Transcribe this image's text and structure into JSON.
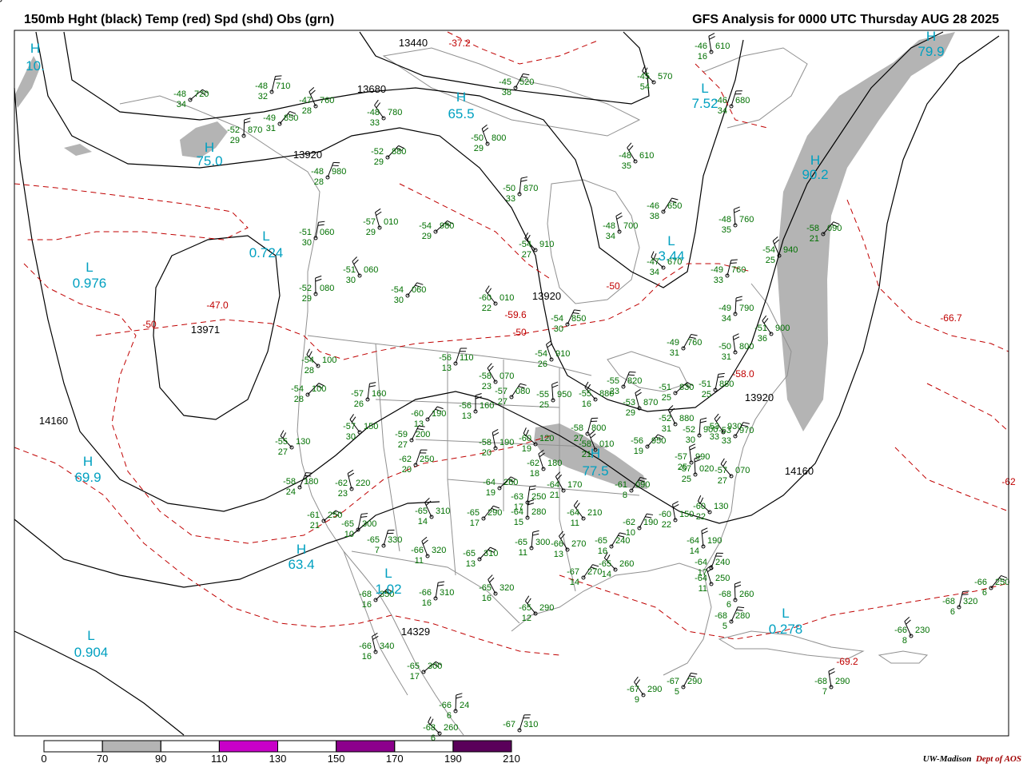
{
  "header": {
    "title_left": "150mb Hght (black) Temp (red) Spd (shd) Obs (grn)",
    "title_right": "GFS Analysis for 0000 UTC Thursday  AUG 28 2025"
  },
  "credit": {
    "institution": "UW-Madison",
    "dept": "Dept of AOS"
  },
  "colors": {
    "height": "#000000",
    "temp": "#c00000",
    "obs": "#007000",
    "centers": "#00a0c0",
    "map_lines": "#909090",
    "shade_70": "#b4b4b4",
    "shade_110": "#c800c8",
    "shade_150": "#8c008c",
    "shade_190": "#5a005a"
  },
  "legend": {
    "ticks": [
      "0",
      "70",
      "90",
      "110",
      "130",
      "150",
      "170",
      "190",
      "210"
    ],
    "bins": [
      {
        "from": 70,
        "to": 90,
        "color": "#b4b4b4"
      },
      {
        "from": 110,
        "to": 130,
        "color": "#c800c8"
      },
      {
        "from": 150,
        "to": 170,
        "color": "#8c008c"
      },
      {
        "from": 190,
        "to": 210,
        "color": "#5a005a"
      }
    ]
  },
  "height_labels": [
    "13440",
    "13680",
    "13920",
    "13971",
    "14160",
    "14160",
    "13920",
    "13920",
    "14329"
  ],
  "temp_labels": [
    "-37.2",
    "-50",
    "-50",
    "-50",
    "-47.0",
    "-66.7",
    "-69.2",
    "-59.6",
    "-58.0",
    "-62"
  ],
  "centers": [
    {
      "type": "H",
      "value": "75.0"
    },
    {
      "type": "H",
      "value": "65.5"
    },
    {
      "type": "H",
      "value": "90.2"
    },
    {
      "type": "H",
      "value": "79.9"
    },
    {
      "type": "H",
      "value": "69.9"
    },
    {
      "type": "H",
      "value": "63.4"
    },
    {
      "type": "H",
      "value": "77.5"
    },
    {
      "type": "H",
      "value": "10."
    },
    {
      "type": "L",
      "value": "0.976"
    },
    {
      "type": "L",
      "value": "0.724"
    },
    {
      "type": "L",
      "value": "7.52"
    },
    {
      "type": "L",
      "value": "3.44"
    },
    {
      "type": "L",
      "value": "1.02"
    },
    {
      "type": "L",
      "value": "0.904"
    },
    {
      "type": "L",
      "value": "0.278"
    }
  ],
  "stations": [
    {
      "t": "-48",
      "h": "720",
      "s": "34"
    },
    {
      "t": "-48",
      "h": "710",
      "s": "32"
    },
    {
      "t": "-47",
      "h": "760",
      "s": "28"
    },
    {
      "t": "-49",
      "h": "850",
      "s": "31"
    },
    {
      "t": "-52",
      "h": "870",
      "s": "29"
    },
    {
      "t": "-48",
      "h": "780",
      "s": "33"
    },
    {
      "t": "-45",
      "h": "520",
      "s": "38"
    },
    {
      "t": "-46",
      "h": "610",
      "s": "16"
    },
    {
      "t": "-45",
      "h": "570",
      "s": "54"
    },
    {
      "t": "-46",
      "h": "680",
      "s": "34"
    },
    {
      "t": "-50",
      "h": "800",
      "s": "29"
    },
    {
      "t": "-52",
      "h": "880",
      "s": "29"
    },
    {
      "t": "-50",
      "h": "870",
      "s": "33"
    },
    {
      "t": "-48",
      "h": "610",
      "s": "35"
    },
    {
      "t": "-46",
      "h": "650",
      "s": "38"
    },
    {
      "t": "-48",
      "h": "760",
      "s": "35"
    },
    {
      "t": "-54",
      "h": "910",
      "s": "27"
    },
    {
      "t": "-48",
      "h": "980",
      "s": "28"
    },
    {
      "t": "-57",
      "h": "010",
      "s": "29"
    },
    {
      "t": "-54",
      "h": "980",
      "s": "29"
    },
    {
      "t": "-51",
      "h": "060",
      "s": "30"
    },
    {
      "t": "-51",
      "h": "060",
      "s": "30"
    },
    {
      "t": "-54",
      "h": "060",
      "s": "30"
    },
    {
      "t": "-52",
      "h": "080",
      "s": "29"
    },
    {
      "t": "-60",
      "h": "010",
      "s": "22"
    },
    {
      "t": "-54",
      "h": "850",
      "s": "30"
    },
    {
      "t": "-48",
      "h": "700",
      "s": "34"
    },
    {
      "t": "-47",
      "h": "670",
      "s": "34"
    },
    {
      "t": "-49",
      "h": "760",
      "s": "33"
    },
    {
      "t": "-54",
      "h": "940",
      "s": "25"
    },
    {
      "t": "-58",
      "h": "090",
      "s": "21"
    },
    {
      "t": "-49",
      "h": "790",
      "s": "34"
    },
    {
      "t": "-51",
      "h": "900",
      "s": "36"
    },
    {
      "t": "-49",
      "h": "760",
      "s": "31"
    },
    {
      "t": "-50",
      "h": "800",
      "s": "31"
    },
    {
      "t": "-54",
      "h": "100",
      "s": "28"
    },
    {
      "t": "-56",
      "h": "110",
      "s": "13"
    },
    {
      "t": "-54",
      "h": "910",
      "s": "26"
    },
    {
      "t": "-54",
      "h": "100",
      "s": "28"
    },
    {
      "t": "-57",
      "h": "160",
      "s": "26"
    },
    {
      "t": "-58",
      "h": "070",
      "s": "23"
    },
    {
      "t": "-57",
      "h": "080",
      "s": "27"
    },
    {
      "t": "-55",
      "h": "950",
      "s": "25"
    },
    {
      "t": "-55",
      "h": "880",
      "s": "16"
    },
    {
      "t": "-55",
      "h": "820",
      "s": "23"
    },
    {
      "t": "-53",
      "h": "870",
      "s": "29"
    },
    {
      "t": "-51",
      "h": "830",
      "s": "25"
    },
    {
      "t": "-51",
      "h": "880",
      "s": "25"
    },
    {
      "t": "-52",
      "h": "880",
      "s": "31"
    },
    {
      "t": "-60",
      "h": "190",
      "s": "13"
    },
    {
      "t": "-56",
      "h": "160",
      "s": "13"
    },
    {
      "t": "-57",
      "h": "150",
      "s": "30"
    },
    {
      "t": "-59",
      "h": "200",
      "s": "27"
    },
    {
      "t": "-58",
      "h": "190",
      "s": "20"
    },
    {
      "t": "-60",
      "h": "120",
      "s": "19"
    },
    {
      "t": "-58",
      "h": "800",
      "s": "27"
    },
    {
      "t": "-58",
      "h": "010",
      "s": "21"
    },
    {
      "t": "-56",
      "h": "950",
      "s": "19"
    },
    {
      "t": "-52",
      "h": "900",
      "s": "30"
    },
    {
      "t": "-53",
      "h": "930",
      "s": "33"
    },
    {
      "t": "-53",
      "h": "970",
      "s": "33"
    },
    {
      "t": "-57",
      "h": "990",
      "s": "25"
    },
    {
      "t": "-55",
      "h": "130",
      "s": "27"
    },
    {
      "t": "-62",
      "h": "250",
      "s": "20"
    },
    {
      "t": "-62",
      "h": "180",
      "s": "18"
    },
    {
      "t": "-64",
      "h": "260",
      "s": "19"
    },
    {
      "t": "-63",
      "h": "250",
      "s": "17"
    },
    {
      "t": "-64",
      "h": "170",
      "s": "21"
    },
    {
      "t": "-61",
      "h": "090",
      "s": "8"
    },
    {
      "t": "-57",
      "h": "020",
      "s": "25"
    },
    {
      "t": "-57",
      "h": "070",
      "s": "27"
    },
    {
      "t": "-58",
      "h": "180",
      "s": "24"
    },
    {
      "t": "-62",
      "h": "220",
      "s": "23"
    },
    {
      "t": "-61",
      "h": "250",
      "s": "21"
    },
    {
      "t": "-65",
      "h": "300",
      "s": "10"
    },
    {
      "t": "-65",
      "h": "310",
      "s": "14"
    },
    {
      "t": "-65",
      "h": "290",
      "s": "17"
    },
    {
      "t": "-64",
      "h": "280",
      "s": "15"
    },
    {
      "t": "-64",
      "h": "210",
      "s": "11"
    },
    {
      "t": "-62",
      "h": "190",
      "s": "10"
    },
    {
      "t": "-60",
      "h": "150",
      "s": "22"
    },
    {
      "t": "-60",
      "h": "130",
      "s": "22"
    },
    {
      "t": "-65",
      "h": "330",
      "s": "7"
    },
    {
      "t": "-66",
      "h": "320",
      "s": "11"
    },
    {
      "t": "-65",
      "h": "310",
      "s": "13"
    },
    {
      "t": "-65",
      "h": "300",
      "s": "11"
    },
    {
      "t": "-66",
      "h": "270",
      "s": "13"
    },
    {
      "t": "-65",
      "h": "240",
      "s": "16"
    },
    {
      "t": "-64",
      "h": "190",
      "s": "14"
    },
    {
      "t": "-65",
      "h": "260",
      "s": "14"
    },
    {
      "t": "-64",
      "h": "240",
      "s": "17"
    },
    {
      "t": "-64",
      "h": "250",
      "s": "11"
    },
    {
      "t": "-68",
      "h": "350",
      "s": "16"
    },
    {
      "t": "-66",
      "h": "310",
      "s": "16"
    },
    {
      "t": "-65",
      "h": "320",
      "s": "16"
    },
    {
      "t": "-67",
      "h": "270",
      "s": "14"
    },
    {
      "t": "-68",
      "h": "260",
      "s": "6"
    },
    {
      "t": "-65",
      "h": "290",
      "s": "12"
    },
    {
      "t": "-68",
      "h": "280",
      "s": "5"
    },
    {
      "t": "-66",
      "h": "340",
      "s": "16"
    },
    {
      "t": "-65",
      "h": "300",
      "s": "17"
    },
    {
      "t": "-68",
      "h": "320",
      "s": "6"
    },
    {
      "t": "-66",
      "h": "230",
      "s": "8"
    },
    {
      "t": "-66",
      "h": "250",
      "s": "6"
    },
    {
      "t": "-66",
      "h": "24",
      "s": "6"
    },
    {
      "t": "-67",
      "h": "290",
      "s": "9"
    },
    {
      "t": "-67",
      "h": "290",
      "s": "5"
    },
    {
      "t": "-68",
      "h": "290",
      "s": "7"
    },
    {
      "t": "-68",
      "h": "260",
      "s": "6"
    },
    {
      "t": "-67",
      "h": "310",
      "s": ""
    },
    {
      "t": "-66",
      "h": "310",
      "s": ""
    }
  ]
}
